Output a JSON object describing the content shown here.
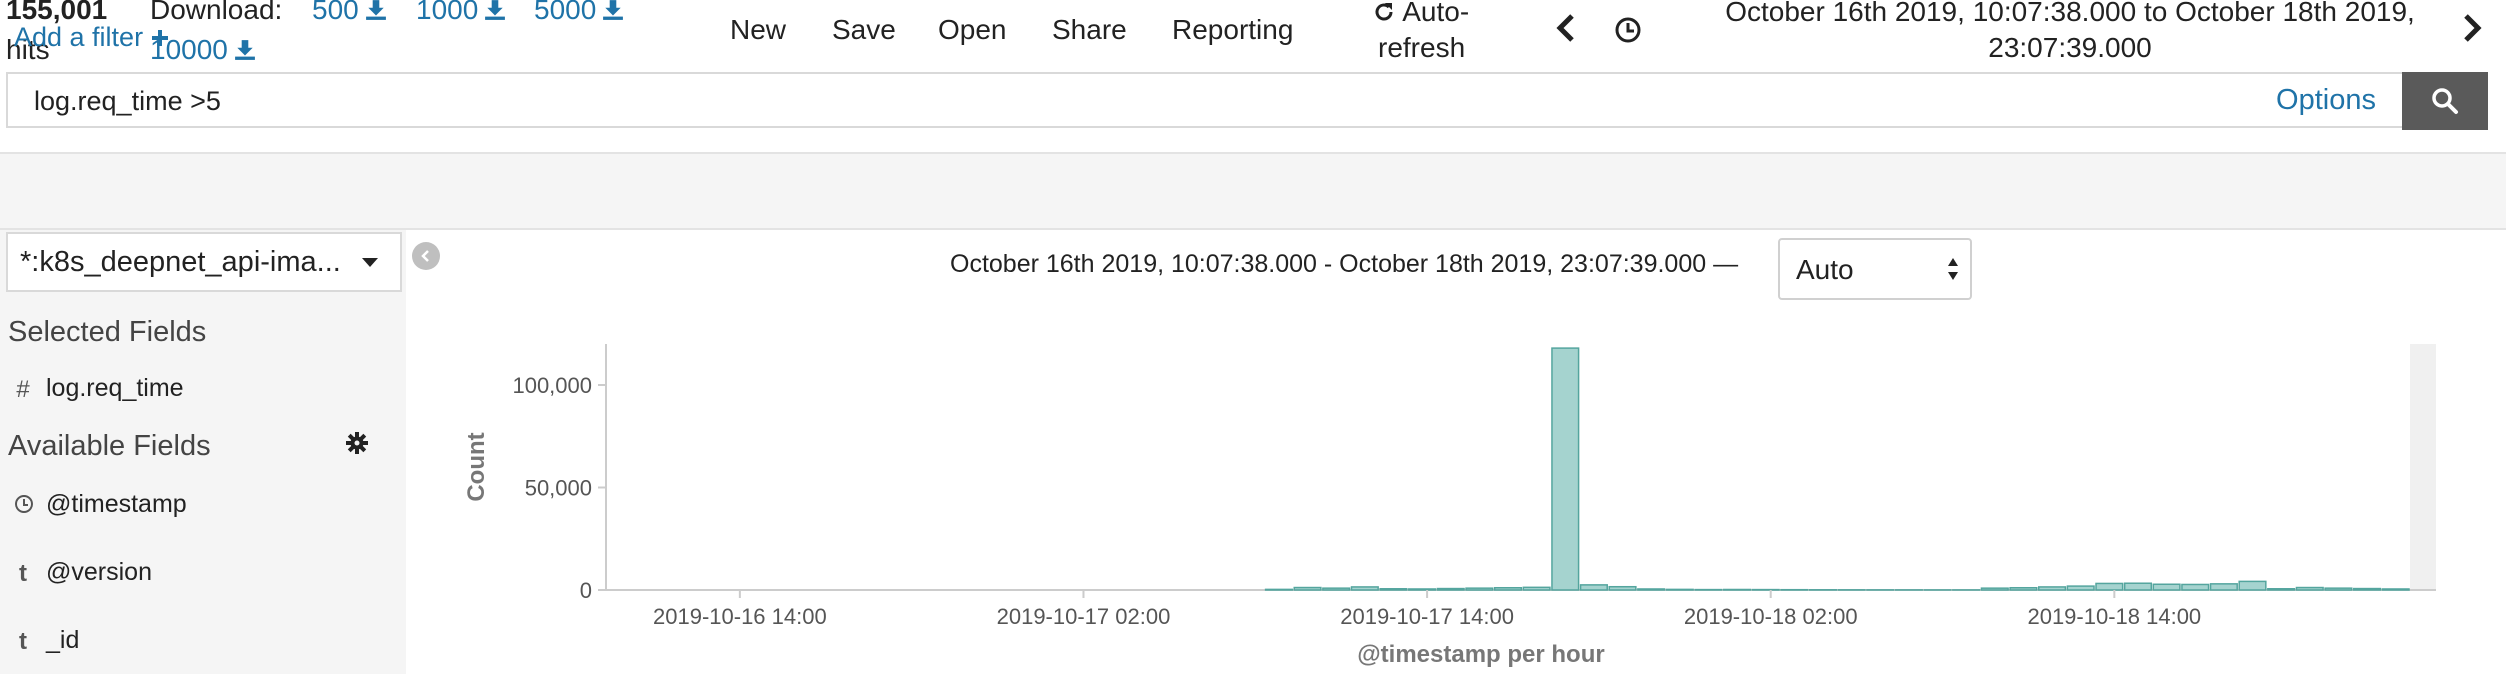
{
  "header": {
    "hits_count": "155,001",
    "hits_label": "hits",
    "download_label": "Download:",
    "download_options": [
      "500",
      "1000",
      "5000",
      "10000"
    ],
    "menu": [
      "New",
      "Save",
      "Open",
      "Share",
      "Reporting"
    ],
    "auto_refresh_line1": "Auto-",
    "auto_refresh_line2": "refresh",
    "date_range_line1": "October 16th 2019, 10:07:38.000 to October 18th 2019,",
    "date_range_line2": "23:07:39.000"
  },
  "query": {
    "value": "log.req_time >5",
    "options_label": "Options"
  },
  "filter": {
    "add_label": "Add a filter"
  },
  "sidebar": {
    "index_pattern": "*:k8s_deepnet_api-ima...",
    "selected_title": "Selected Fields",
    "selected_fields": [
      {
        "type": "#",
        "name": "log.req_time"
      }
    ],
    "available_title": "Available Fields",
    "available_fields": [
      {
        "type": "clock",
        "name": "@timestamp"
      },
      {
        "type": "t",
        "name": "@version"
      },
      {
        "type": "t",
        "name": "_id"
      }
    ]
  },
  "histogram": {
    "time_caption": "October 16th 2019, 10:07:38.000 - October 18th 2019, 23:07:39.000 —",
    "interval": "Auto"
  },
  "colors": {
    "link": "#1f73a8",
    "bar_fill": "#a5d3cf",
    "bar_stroke": "#54a59e",
    "search_button": "#5a5a5a"
  },
  "chart_data": {
    "type": "bar",
    "xlabel": "@timestamp per hour",
    "ylabel": "Count",
    "ylim": [
      0,
      120000
    ],
    "y_ticks": [
      0,
      50000,
      100000
    ],
    "y_tick_labels": [
      "0",
      "50,000",
      "100,000"
    ],
    "x_ticks": [
      "2019-10-16 14:00",
      "2019-10-17 02:00",
      "2019-10-17 14:00",
      "2019-10-18 02:00",
      "2019-10-18 14:00"
    ],
    "x_tick_hour_index": [
      4,
      16,
      28,
      40,
      52
    ],
    "start_hour_offset": 0,
    "values": [
      0,
      0,
      0,
      0,
      0,
      0,
      0,
      0,
      0,
      0,
      0,
      0,
      0,
      0,
      0,
      0,
      0,
      0,
      0,
      0,
      0,
      0,
      0,
      300,
      1200,
      900,
      1500,
      600,
      500,
      700,
      900,
      1100,
      1300,
      118000,
      2500,
      1600,
      500,
      300,
      200,
      250,
      200,
      150,
      100,
      80,
      60,
      50,
      40,
      40,
      900,
      1100,
      1500,
      1900,
      3200,
      3300,
      2800,
      2700,
      3000,
      4200,
      600,
      1200,
      900,
      700,
      500
    ]
  }
}
